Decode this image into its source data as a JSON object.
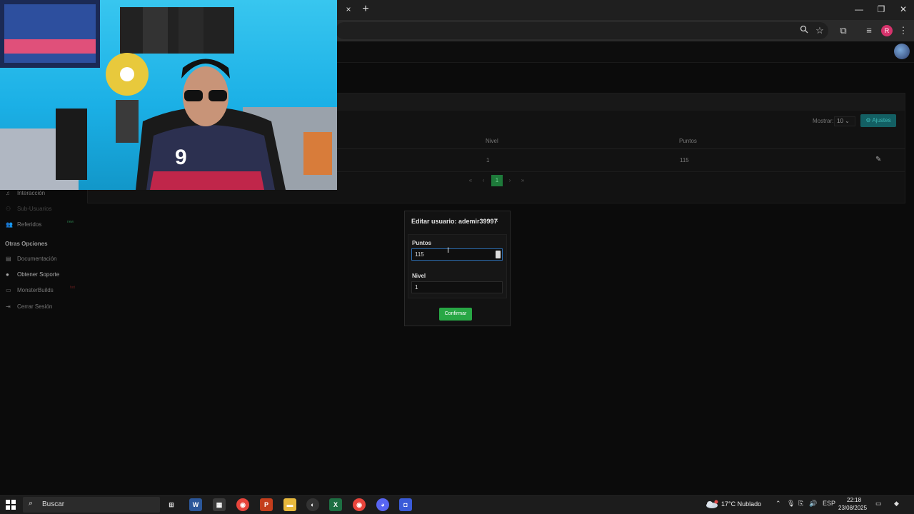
{
  "browser": {
    "tab_close": "×",
    "new_tab": "+",
    "profile_initial": "R",
    "window_controls": [
      "—",
      "❐",
      "✕"
    ]
  },
  "table": {
    "show_label": "Mostrar:",
    "show_value": "10",
    "settings_label": "⚙ Ajustes",
    "headers": [
      "Nivel",
      "Puntos"
    ],
    "rows": [
      {
        "level": "1",
        "points": "115"
      }
    ],
    "pagination": {
      "first": "«",
      "prev": "‹",
      "current": "1",
      "next": "›",
      "last": "»"
    }
  },
  "sidebar": {
    "items": [
      {
        "label": "Interacción",
        "icon": "music-icon"
      },
      {
        "label": "Sub-Usuarios",
        "icon": "users-icon"
      },
      {
        "label": "Referidos",
        "icon": "user-plus-icon",
        "badge": "new"
      }
    ],
    "section_other": "Otras Opciones",
    "other_items": [
      {
        "label": "Documentación",
        "icon": "book-icon"
      },
      {
        "label": "Obtener Soporte",
        "icon": "support-icon"
      },
      {
        "label": "MonsterBuilds",
        "icon": "laptop-icon",
        "badge": "hot"
      },
      {
        "label": "Cerrar Sesión",
        "icon": "logout-icon"
      }
    ]
  },
  "modal": {
    "title": "Editar usuario: ademir39997",
    "close": "×",
    "points_label": "Puntos",
    "points_value": "115",
    "level_label": "Nivel",
    "level_value": "1",
    "confirm_label": "Confirmar"
  },
  "taskbar": {
    "search_placeholder": "Buscar",
    "weather": "17°C  Nublado",
    "lang": "ESP",
    "time": "22:18",
    "date": "23/08/2025"
  },
  "colors": {
    "accent_green": "#28a745",
    "settings_teal": "#135f63",
    "input_focus": "#2b6cb0"
  }
}
